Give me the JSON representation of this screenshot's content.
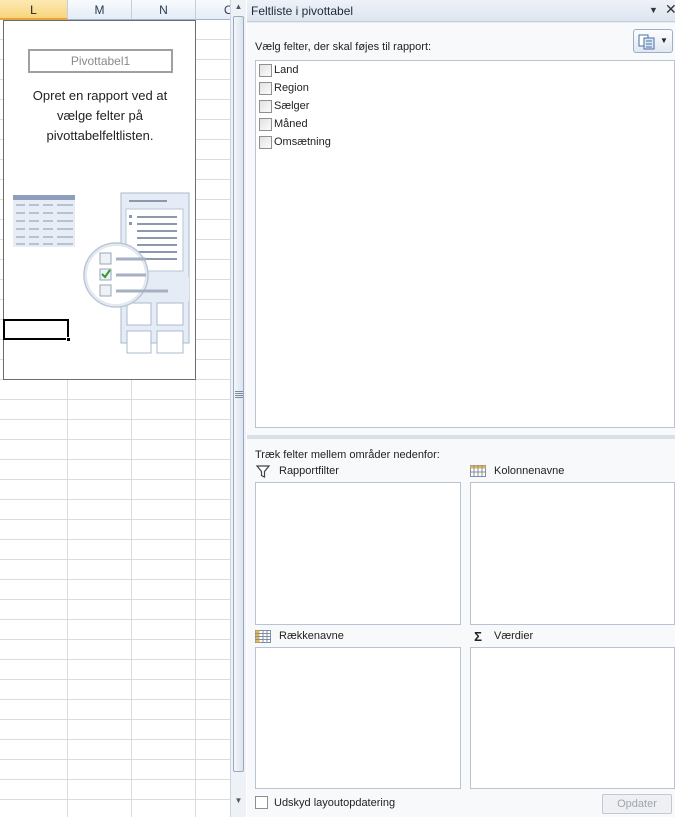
{
  "sheet": {
    "columns": [
      "L",
      "M",
      "N",
      "O"
    ],
    "selected_column": "L",
    "pivot_name": "Pivottabel1",
    "instructions": "Opret en rapport ved at vælge felter på pivottabelfeltlisten."
  },
  "pane": {
    "title": "Feltliste i pivottabel",
    "choose_label": "Vælg felter, der skal føjes til rapport:",
    "fields": [
      {
        "label": "Land",
        "checked": false
      },
      {
        "label": "Region",
        "checked": false
      },
      {
        "label": "Sælger",
        "checked": false
      },
      {
        "label": "Måned",
        "checked": false
      },
      {
        "label": "Omsætning",
        "checked": false
      }
    ],
    "drag_label": "Træk felter mellem områder nedenfor:",
    "areas": {
      "report_filter": "Rapportfilter",
      "column_labels": "Kolonnenavne",
      "row_labels": "Rækkenavne",
      "values": "Værdier"
    },
    "defer_label": "Udskyd layoutopdatering",
    "update_label": "Opdater",
    "sigma_glyph": "Σ"
  },
  "icons": {
    "filter": "funnel-icon",
    "columns": "column-labels-icon",
    "rows": "row-labels-icon",
    "values": "sigma-icon",
    "layout": "field-list-layout-icon",
    "close": "close-icon",
    "dropdown": "chevron-down-icon"
  },
  "colors": {
    "selected_column": "#f8d57a",
    "pane_background": "#e9edf3",
    "check_green": "#2e9b2e"
  }
}
